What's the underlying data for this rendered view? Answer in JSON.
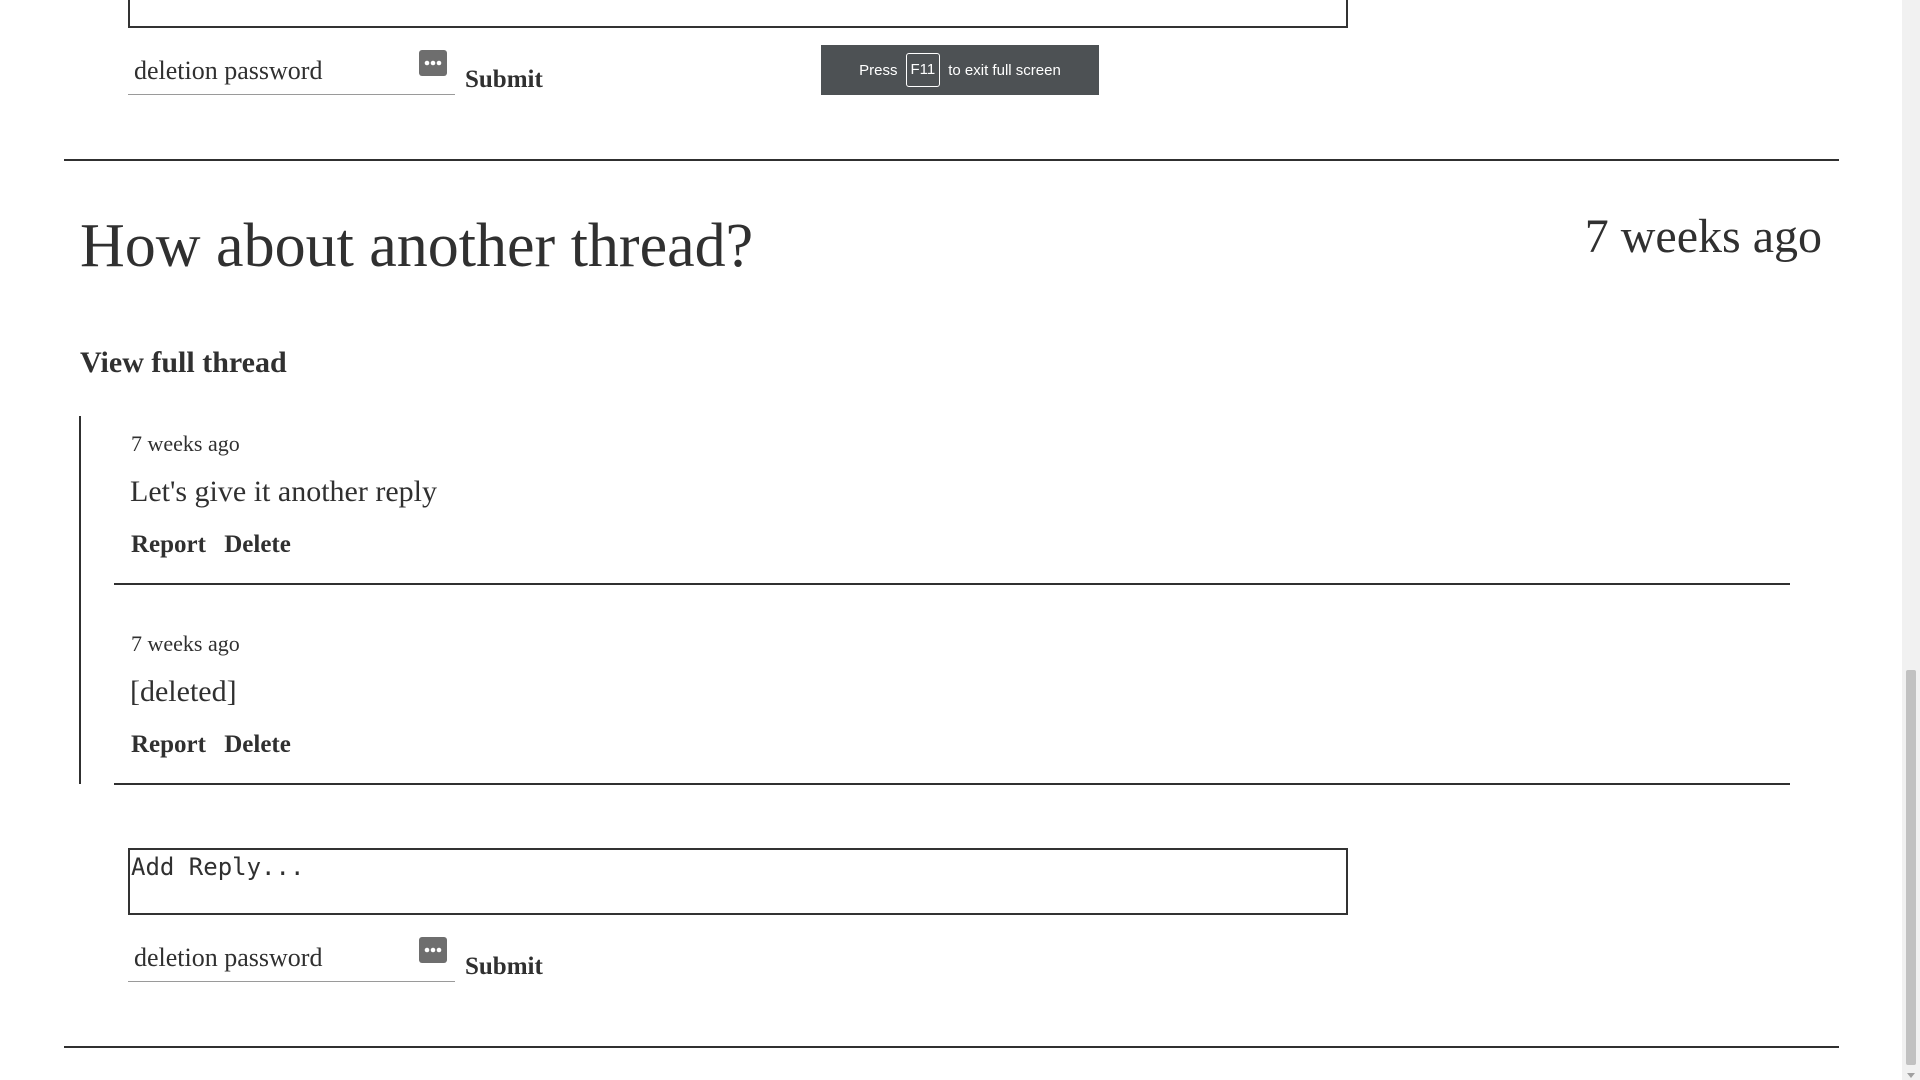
{
  "fullscreen_notice": {
    "prefix": "Press",
    "key": "F11",
    "suffix": "to exit full screen"
  },
  "previous_form": {
    "password_placeholder": "deletion password",
    "submit_label": "Submit"
  },
  "thread": {
    "title": "How about another thread?",
    "time": "7 weeks ago",
    "view_full_label": "View full thread",
    "replies": [
      {
        "time": "7 weeks ago",
        "body": "Let's give it another reply",
        "report_label": "Report",
        "delete_label": "Delete"
      },
      {
        "time": "7 weeks ago",
        "body": "[deleted]",
        "report_label": "Report",
        "delete_label": "Delete"
      }
    ],
    "reply_form": {
      "reply_placeholder": "Add Reply...",
      "password_placeholder": "deletion password",
      "submit_label": "Submit"
    }
  }
}
